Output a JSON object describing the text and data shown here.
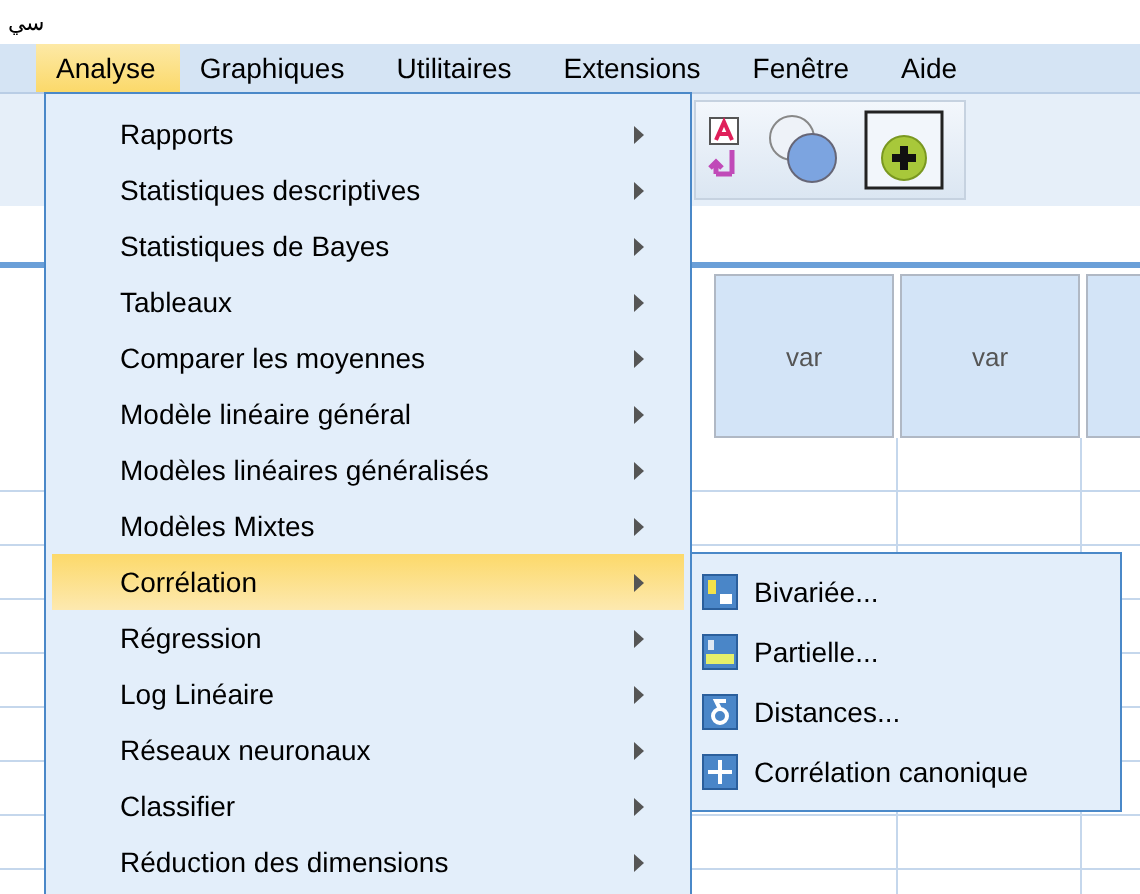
{
  "title_glyph": "سي",
  "menubar": [
    {
      "label": "Analyse",
      "selected": true
    },
    {
      "label": "Graphiques",
      "selected": false
    },
    {
      "label": "Utilitaires",
      "selected": false
    },
    {
      "label": "Extensions",
      "selected": false
    },
    {
      "label": "Fenêtre",
      "selected": false
    },
    {
      "label": "Aide",
      "selected": false
    }
  ],
  "grid": {
    "columns": [
      "var",
      "var"
    ]
  },
  "menu": {
    "items": [
      {
        "label": "Rapports",
        "selected": false
      },
      {
        "label": "Statistiques descriptives",
        "selected": false
      },
      {
        "label": "Statistiques de Bayes",
        "selected": false
      },
      {
        "label": "Tableaux",
        "selected": false
      },
      {
        "label": "Comparer les moyennes",
        "selected": false
      },
      {
        "label": "Modèle linéaire général",
        "selected": false
      },
      {
        "label": "Modèles linéaires généralisés",
        "selected": false
      },
      {
        "label": "Modèles Mixtes",
        "selected": false
      },
      {
        "label": "Corrélation",
        "selected": true
      },
      {
        "label": "Régression",
        "selected": false
      },
      {
        "label": "Log Linéaire",
        "selected": false
      },
      {
        "label": "Réseaux neuronaux",
        "selected": false
      },
      {
        "label": "Classifier",
        "selected": false
      },
      {
        "label": "Réduction des dimensions",
        "selected": false
      }
    ]
  },
  "submenu": {
    "items": [
      {
        "label": "Bivariée...",
        "kind": "bivariate"
      },
      {
        "label": "Partielle...",
        "kind": "partial"
      },
      {
        "label": "Distances...",
        "kind": "distance"
      },
      {
        "label": "Corrélation canonique",
        "kind": "canonical"
      }
    ]
  }
}
